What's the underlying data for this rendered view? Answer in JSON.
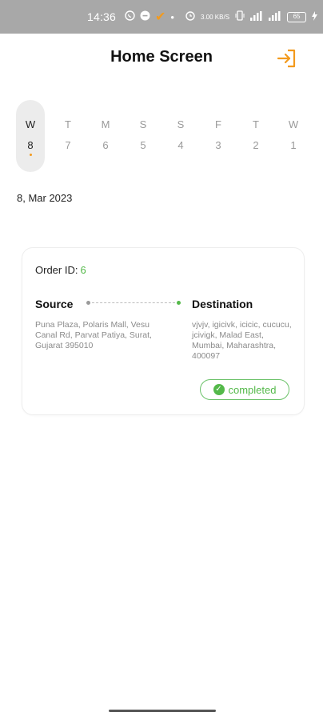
{
  "status_bar": {
    "time": "14:36",
    "left_icons": [
      "whatsapp-icon",
      "minus-circle-icon",
      "check-icon",
      "dot-icon"
    ],
    "right_icons": [
      "alarm-icon",
      "data-speed-icon",
      "vibrate-icon",
      "signal-icon",
      "signal-icon",
      "battery-icon",
      "charging-icon"
    ],
    "data_speed": "3.00 KB/S",
    "battery_level": "65",
    "accent_color": "#f39a1d"
  },
  "header": {
    "title": "Home Screen",
    "logout_icon": "logout-icon",
    "icon_color": "#f39a1d"
  },
  "week": [
    {
      "weekday": "W",
      "day": "8",
      "selected": true
    },
    {
      "weekday": "T",
      "day": "7",
      "selected": false
    },
    {
      "weekday": "M",
      "day": "6",
      "selected": false
    },
    {
      "weekday": "S",
      "day": "5",
      "selected": false
    },
    {
      "weekday": "S",
      "day": "4",
      "selected": false
    },
    {
      "weekday": "F",
      "day": "3",
      "selected": false
    },
    {
      "weekday": "T",
      "day": "2",
      "selected": false
    },
    {
      "weekday": "W",
      "day": "1",
      "selected": false
    }
  ],
  "selected_date": "8, Mar 2023",
  "order": {
    "id_label": "Order ID:",
    "id_value": "6",
    "source_label": "Source",
    "source_address": "Puna Plaza, Polaris Mall, Vesu Canal Rd, Parvat Patiya, Surat, Gujarat 395010",
    "destination_label": "Destination",
    "destination_address": "vjvjv, igicivk, icicic, cucucu, jcivigk, Malad East, Mumbai, Maharashtra, 400097",
    "status": "completed",
    "status_color": "#54b94a"
  }
}
